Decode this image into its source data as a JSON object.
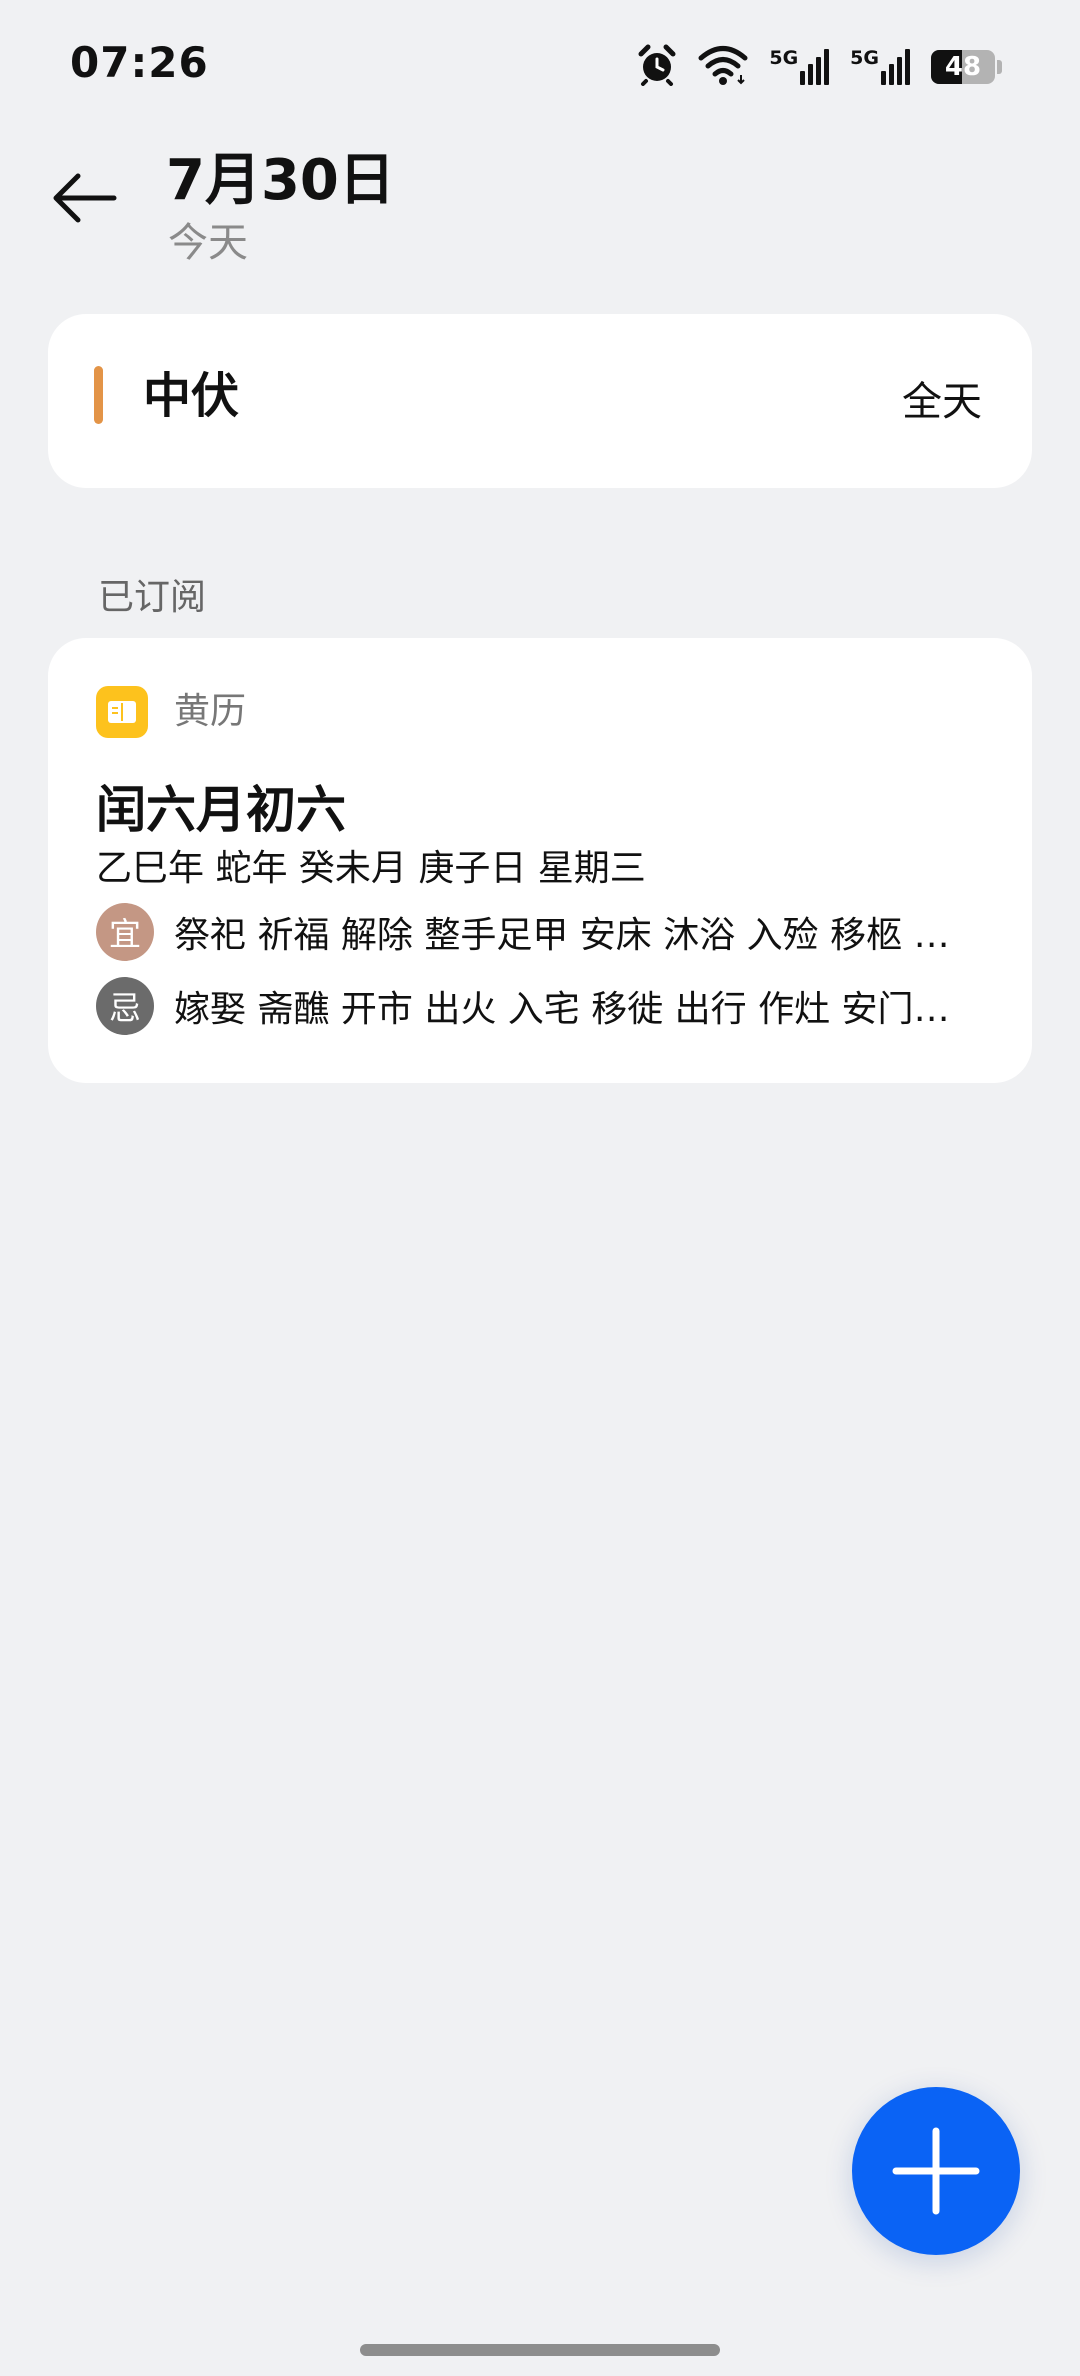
{
  "status_bar": {
    "time": "07:26",
    "network_1": "5G",
    "network_2": "5G",
    "battery": "48",
    "battery_level": 0.48
  },
  "header": {
    "title": "7月30日",
    "subtitle": "今天"
  },
  "event": {
    "title": "中伏",
    "time": "全天",
    "accent_color": "#e39447"
  },
  "subscribed": {
    "section_label": "已订阅",
    "almanac": {
      "name": "黄历",
      "lunar_date": "闰六月初六",
      "ganzhi": "乙巳年 蛇年 癸未月 庚子日 星期三",
      "suitable_badge": "宜",
      "suitable_items": "祭祀 祈福 解除 整手足甲 安床 沐浴 入殓 移柩 破…",
      "avoid_badge": "忌",
      "avoid_items": "嫁娶 斋醮 开市 出火 入宅 移徙 出行 作灶 安门 伐木",
      "icon_color": "#fdc21d",
      "suitable_color": "#c49784",
      "avoid_color": "#6b6b6b"
    }
  },
  "fab": {
    "icon": "plus-icon",
    "color": "#0a63f5"
  }
}
